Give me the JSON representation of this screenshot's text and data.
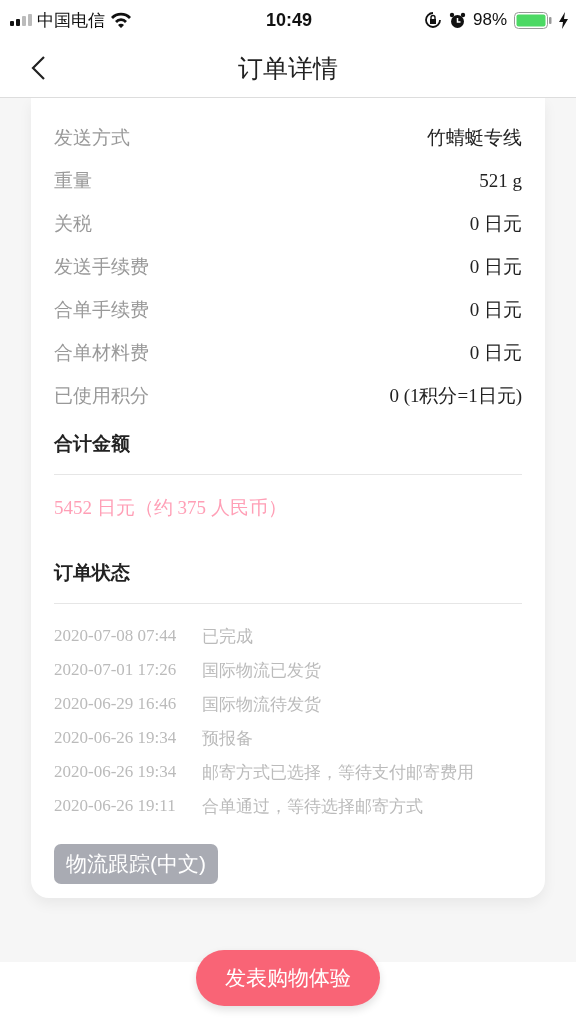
{
  "status_bar": {
    "carrier": "中国电信",
    "time": "10:49",
    "battery": "98%"
  },
  "nav": {
    "title": "订单详情"
  },
  "details": [
    {
      "label": "发送方式",
      "value": "竹蜻蜓专线"
    },
    {
      "label": "重量",
      "value": "521 g"
    },
    {
      "label": "关税",
      "value": "0 日元"
    },
    {
      "label": "发送手续费",
      "value": "0 日元"
    },
    {
      "label": "合单手续费",
      "value": "0 日元"
    },
    {
      "label": "合单材料费",
      "value": "0 日元"
    },
    {
      "label": "已使用积分",
      "value": "0 (1积分=1日元)"
    }
  ],
  "total": {
    "heading": "合计金额",
    "amount": "5452 日元（约 375 人民币）"
  },
  "order_status": {
    "heading": "订单状态",
    "events": [
      {
        "time": "2020-07-08 07:44",
        "text": "已完成"
      },
      {
        "time": "2020-07-01 17:26",
        "text": "国际物流已发货"
      },
      {
        "time": "2020-06-29 16:46",
        "text": "国际物流待发货"
      },
      {
        "time": "2020-06-26 19:34",
        "text": "预报备"
      },
      {
        "time": "2020-06-26 19:34",
        "text": "邮寄方式已选择，等待支付邮寄费用"
      },
      {
        "time": "2020-06-26 19:11",
        "text": "合单通过，等待选择邮寄方式"
      }
    ],
    "tracking_button": "物流跟踪(中文)"
  },
  "review_button": "发表购物体验"
}
